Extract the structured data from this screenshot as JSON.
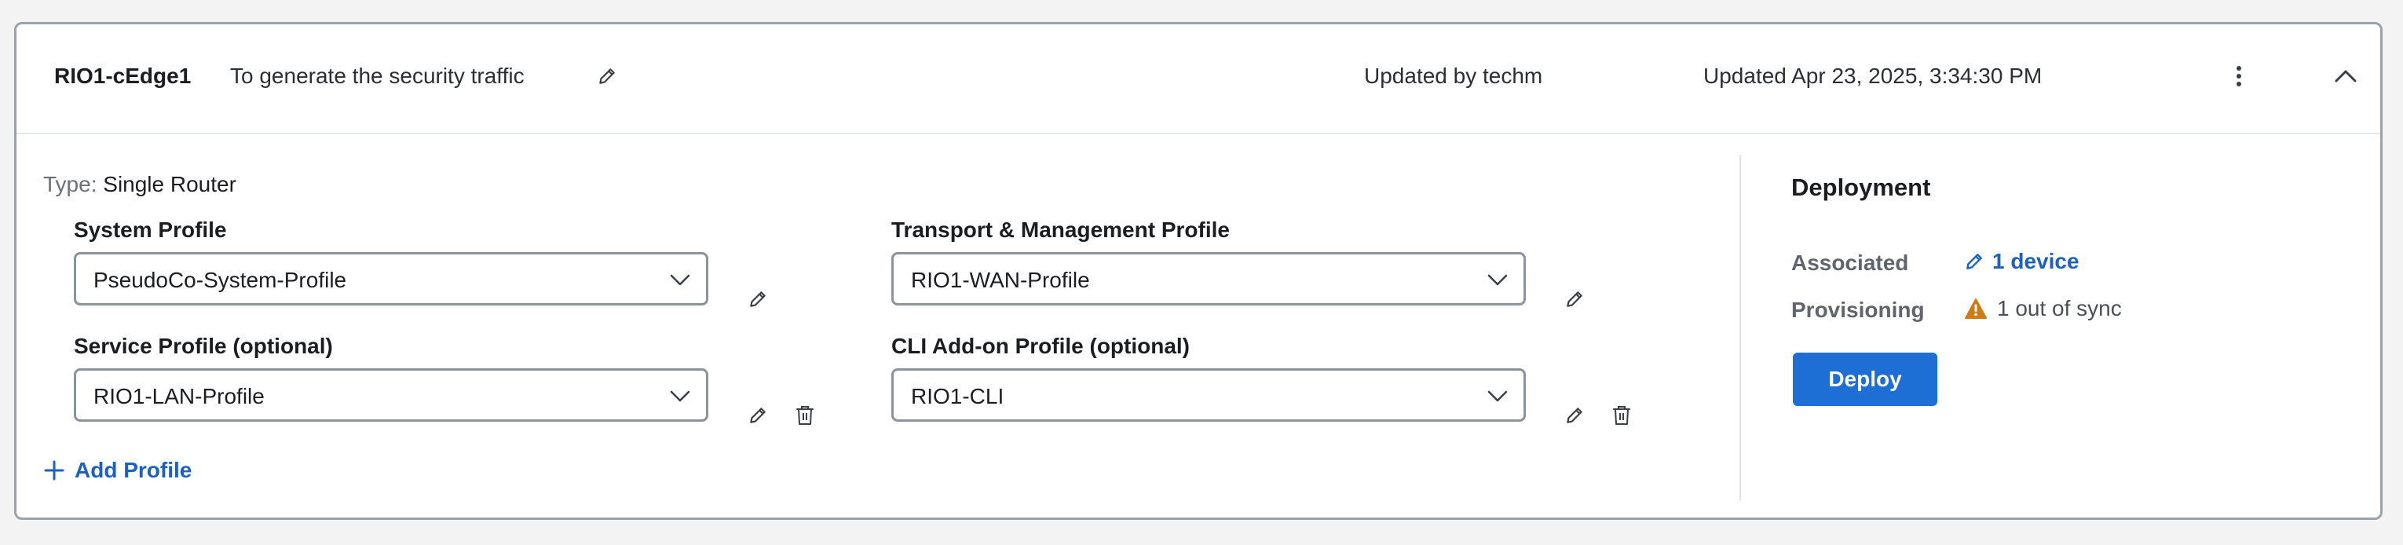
{
  "header": {
    "device_name": "RIO1-cEdge1",
    "description": "To generate the security traffic",
    "updated_by": "Updated by techm",
    "updated_at": "Updated Apr 23, 2025, 3:34:30 PM"
  },
  "type": {
    "label": "Type:",
    "value": "Single Router"
  },
  "profiles": {
    "system": {
      "label": "System Profile",
      "value": "PseudoCo-System-Profile"
    },
    "transport": {
      "label": "Transport & Management Profile",
      "value": "RIO1-WAN-Profile"
    },
    "service": {
      "label": "Service Profile (optional)",
      "value": "RIO1-LAN-Profile"
    },
    "cli": {
      "label": "CLI Add-on Profile (optional)",
      "value": "RIO1-CLI"
    }
  },
  "add_profile_label": "Add Profile",
  "deployment": {
    "title": "Deployment",
    "associated_label": "Associated",
    "associated_value": "1 device",
    "provisioning_label": "Provisioning",
    "provisioning_value": "1 out of sync",
    "deploy_button": "Deploy"
  },
  "colors": {
    "accent": "#1a61c4",
    "button": "#1d6fd6",
    "warning": "#d07a12",
    "border": "#8b939c"
  },
  "icons": [
    "pencil-icon",
    "kebab-menu-icon",
    "chevron-up-icon",
    "chevron-down-icon",
    "trash-icon",
    "plus-icon",
    "warning-icon"
  ]
}
